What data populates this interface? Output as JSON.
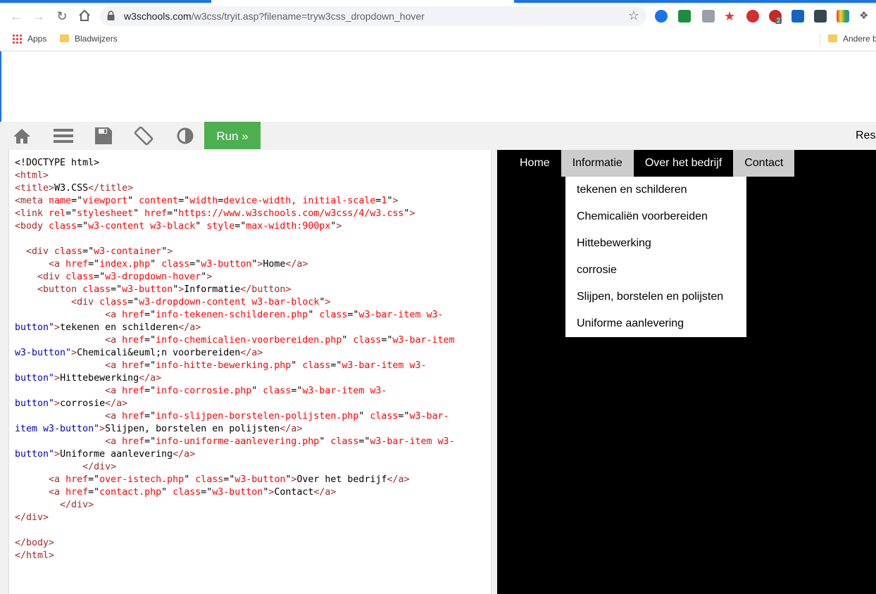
{
  "browser": {
    "url_host": "w3schools.com",
    "url_path": "/w3css/tryit.asp?filename=tryw3css_dropdown_hover",
    "bookmarks": [
      {
        "label": "Apps"
      },
      {
        "label": "Bladwijzers"
      }
    ],
    "other_bookmarks": "Andere b",
    "ext_badges": [
      "2"
    ]
  },
  "toolbar": {
    "run_label": "Run »",
    "result_label": "Resu"
  },
  "code_lines": [
    "<!DOCTYPE html>",
    "<html>",
    "<title>W3.CSS</title>",
    "<meta name=\"viewport\" content=\"width=device-width, initial-scale=1\">",
    "<link rel=\"stylesheet\" href=\"https://www.w3schools.com/w3css/4/w3.css\">",
    "<body class=\"w3-content w3-black\" style=\"max-width:900px\">",
    "",
    "  <div class=\"w3-container\">",
    "      <a href=\"index.php\" class=\"w3-button\">Home</a>",
    "    <div class=\"w3-dropdown-hover\">",
    "    <button class=\"w3-button\">Informatie</button>",
    "          <div class=\"w3-dropdown-content w3-bar-block\">",
    "                <a href=\"info-tekenen-schilderen.php\" class=\"w3-bar-item w3-",
    "button\">tekenen en schilderen</a>",
    "                <a href=\"info-chemicalien-voorbereiden.php\" class=\"w3-bar-item",
    "w3-button\">Chemicali&euml;n voorbereiden</a>",
    "                <a href=\"info-hitte-bewerking.php\" class=\"w3-bar-item w3-",
    "button\">Hittebewerking</a>",
    "                <a href=\"info-corrosie.php\" class=\"w3-bar-item w3-",
    "button\">corrosie</a>",
    "                <a href=\"info-slijpen-borstelen-polijsten.php\" class=\"w3-bar-",
    "item w3-button\">Slijpen, borstelen en polijsten</a>",
    "                <a href=\"info-uniforme-aanlevering.php\" class=\"w3-bar-item w3-",
    "button\">Uniforme aanlevering</a>",
    "            </div>",
    "      <a href=\"over-istech.php\" class=\"w3-button\">Over het bedrijf</a>",
    "      <a href=\"contact.php\" class=\"w3-button\">Contact</a>",
    "        </div>",
    "</div>",
    "",
    "</body>",
    "</html>"
  ],
  "result_nav": [
    {
      "label": "Home",
      "style": "dark"
    },
    {
      "label": "Informatie",
      "style": "light"
    },
    {
      "label": "Over het bedrijf",
      "style": "dark"
    },
    {
      "label": "Contact",
      "style": "light"
    }
  ],
  "dropdown_items": [
    "tekenen en schilderen",
    "Chemicaliën voorbereiden",
    "Hittebewerking",
    "corrosie",
    "Slijpen, borstelen en polijsten",
    "Uniforme aanlevering"
  ],
  "colors": {
    "run_green": "#4caf50",
    "tag": "#a52a2a",
    "attribute": "#ff0000",
    "value": "#0000cc",
    "nav_light": "#cccccc"
  }
}
